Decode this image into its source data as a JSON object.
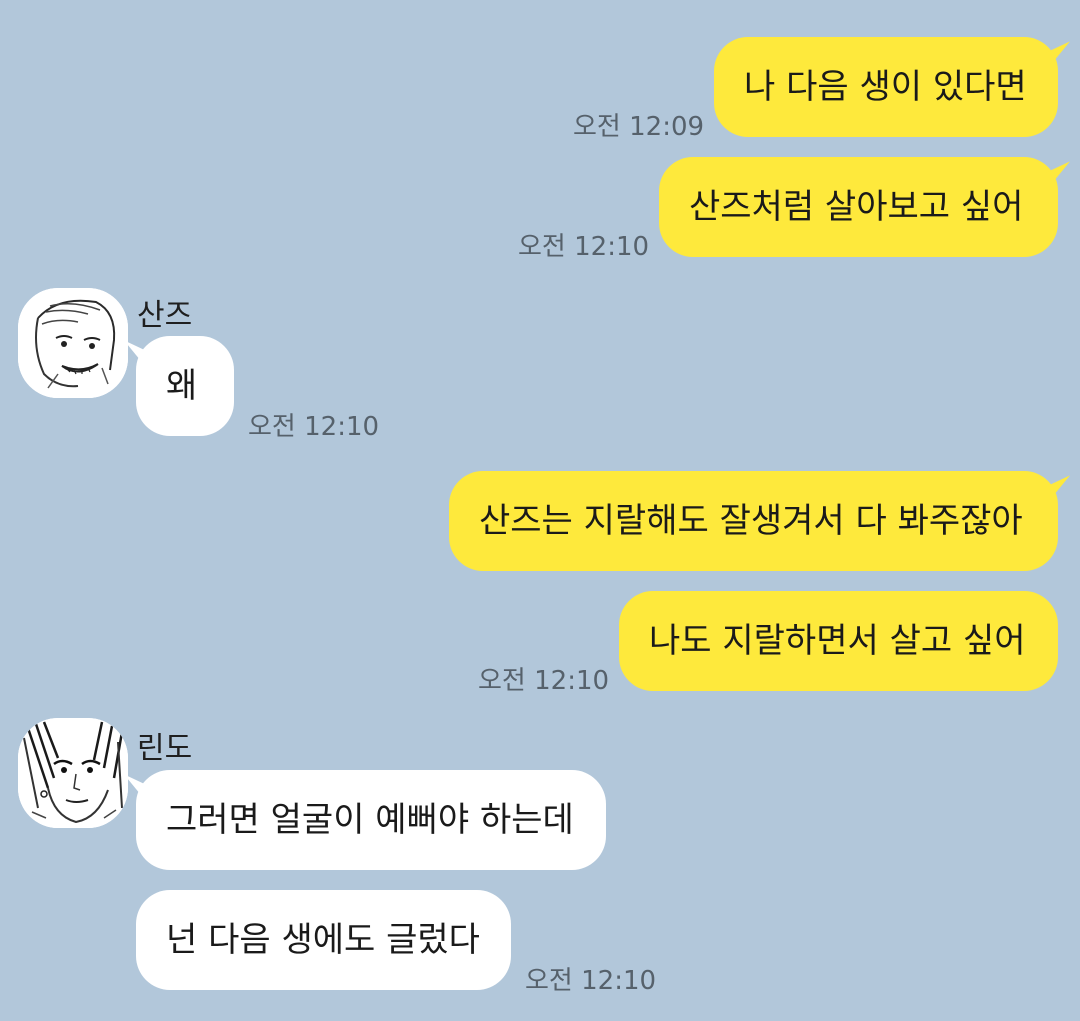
{
  "messages": [
    {
      "sender": "me",
      "text": "나 다음 생이 있다면",
      "time": "오전 12:09"
    },
    {
      "sender": "me",
      "text": "산즈처럼 살아보고 싶어",
      "time": "오전 12:10"
    },
    {
      "sender": "산즈",
      "text": "왜",
      "time": "오전 12:10"
    },
    {
      "sender": "me",
      "text": "산즈는 지랄해도 잘생겨서 다 봐주잖아",
      "time": ""
    },
    {
      "sender": "me",
      "text": "나도 지랄하면서 살고 싶어",
      "time": "오전 12:10"
    },
    {
      "sender": "린도",
      "text": "그러면 얼굴이 예뻐야 하는데",
      "time": ""
    },
    {
      "sender": "린도",
      "text": "넌 다음 생에도 글렀다",
      "time": "오전 12:10"
    }
  ],
  "contacts": {
    "sanzu": {
      "name": "산즈",
      "avatar_icon": "sketch-portrait-icon"
    },
    "rindo": {
      "name": "린도",
      "avatar_icon": "sketch-portrait-icon"
    }
  },
  "colors": {
    "background": "#b2c7da",
    "my_bubble": "#fee93c",
    "their_bubble": "#ffffff",
    "timestamp": "#56616b"
  }
}
